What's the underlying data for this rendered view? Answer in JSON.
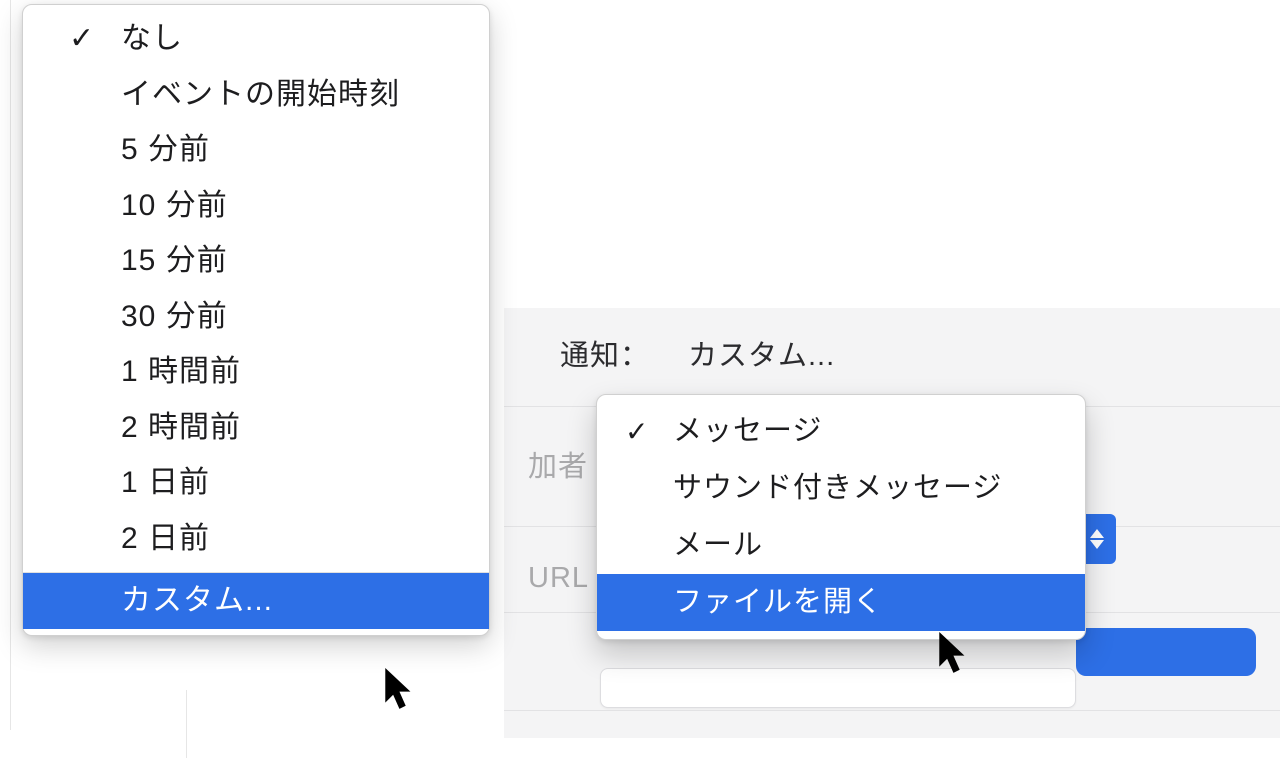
{
  "left_menu": {
    "items": [
      {
        "label": "なし",
        "checked": true,
        "highlight": false
      },
      {
        "label": "イベントの開始時刻",
        "checked": false,
        "highlight": false
      },
      {
        "label": "5 分前",
        "checked": false,
        "highlight": false
      },
      {
        "label": "10 分前",
        "checked": false,
        "highlight": false
      },
      {
        "label": "15 分前",
        "checked": false,
        "highlight": false
      },
      {
        "label": "30 分前",
        "checked": false,
        "highlight": false
      },
      {
        "label": "1 時間前",
        "checked": false,
        "highlight": false
      },
      {
        "label": "2 時間前",
        "checked": false,
        "highlight": false
      },
      {
        "label": "1 日前",
        "checked": false,
        "highlight": false
      },
      {
        "label": "2 日前",
        "checked": false,
        "highlight": false
      }
    ],
    "custom_label": "カスタム...",
    "checkmark_glyph": "✓"
  },
  "right_panel": {
    "notification_field_label": "通知：",
    "notification_value": "カスタム...",
    "partial_attendee_label": "加者",
    "partial_url_label": "URL"
  },
  "right_menu": {
    "items": [
      {
        "label": "メッセージ",
        "checked": true,
        "highlight": false
      },
      {
        "label": "サウンド付きメッセージ",
        "checked": false,
        "highlight": false
      },
      {
        "label": "メール",
        "checked": false,
        "highlight": false
      },
      {
        "label": "ファイルを開く",
        "checked": false,
        "highlight": true
      }
    ],
    "checkmark_glyph": "✓"
  }
}
